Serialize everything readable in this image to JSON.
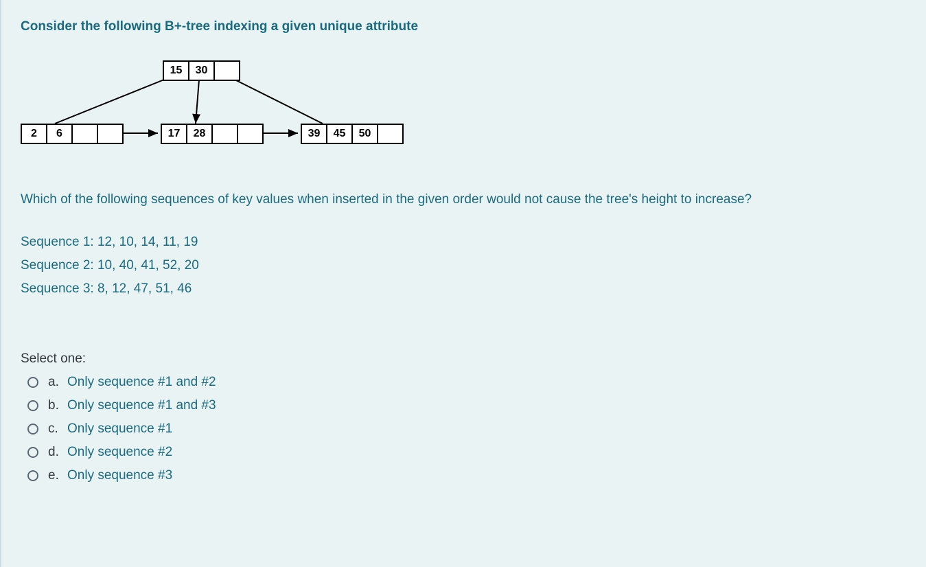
{
  "title": "Consider the following B+-tree indexing a given unique attribute",
  "tree": {
    "root": [
      "15",
      "30",
      ""
    ],
    "leaf1": [
      "2",
      "6",
      ""
    ],
    "leaf2": [
      "17",
      "28",
      ""
    ],
    "leaf3": [
      "39",
      "45",
      "50"
    ]
  },
  "question": "Which of the following sequences of key values when inserted in the given order would not cause the tree's height to increase?",
  "sequences": {
    "s1": "Sequence 1: 12, 10, 14, 11, 19",
    "s2": "Sequence 2: 10, 40, 41, 52, 20",
    "s3": "Sequence 3: 8, 12, 47, 51, 46"
  },
  "select_label": "Select one:",
  "options": {
    "a": {
      "letter": "a.",
      "text": "Only sequence #1 and #2"
    },
    "b": {
      "letter": "b.",
      "text": "Only sequence #1 and #3"
    },
    "c": {
      "letter": "c.",
      "text": "Only sequence #1"
    },
    "d": {
      "letter": "d.",
      "text": "Only sequence #2"
    },
    "e": {
      "letter": "e.",
      "text": "Only sequence #3"
    }
  }
}
